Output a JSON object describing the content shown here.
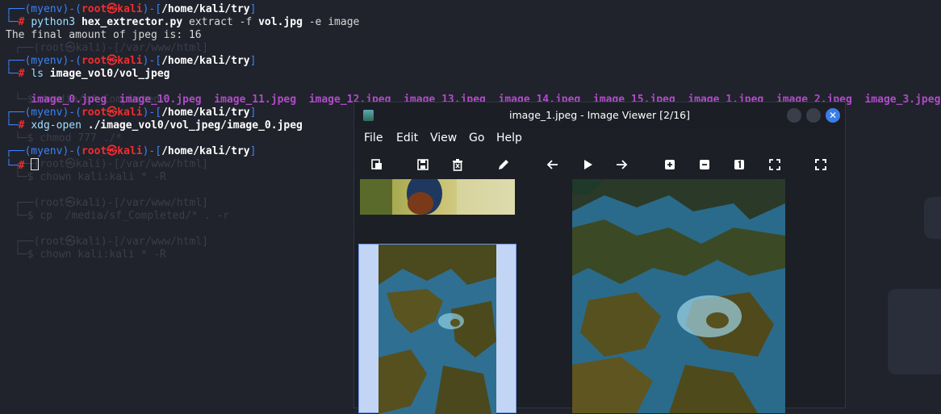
{
  "terminal": {
    "blocks": [
      {
        "prompt": {
          "env": "(myenv)",
          "user": "root",
          "host": "kali",
          "path": "/home/kali/try"
        },
        "command": {
          "cmd": "python3",
          "script": "hex_extrector.py",
          "flag1": "extract -f",
          "file": "vol.jpg",
          "rest": "-e image"
        },
        "output": "The final amount of jpeg is: 16"
      },
      {
        "prompt": {
          "env": "(myenv)",
          "user": "root",
          "host": "kali",
          "path": "/home/kali/try"
        },
        "command": {
          "cmd": "ls",
          "arg": "image_vol0/vol_jpeg"
        },
        "files": [
          "image_0.jpeg",
          "image_10.jpeg",
          "image_11.jpeg",
          "image_12.jpeg",
          "image_13.jpeg",
          "image_14.jpeg",
          "image_15.jpeg",
          "image_1.jpeg",
          "image_2.jpeg",
          "image_3.jpeg"
        ]
      },
      {
        "prompt": {
          "env": "(myenv)",
          "user": "root",
          "host": "kali",
          "path": "/home/kali/try"
        },
        "command": {
          "cmd": "xdg-open",
          "arg": "./image_vol0/vol_jpeg/image_0.jpeg"
        }
      },
      {
        "prompt": {
          "env": "(myenv)",
          "user": "root",
          "host": "kali",
          "path": "/home/kali/try"
        }
      }
    ],
    "ghost_lines": [
      "/var/www/html",
      "/media/sf_Completed/",
      "chmod 777 ./*",
      "/var/www/html",
      "chown kali:kali * -R",
      "/var/www/html",
      "cp  /media/sf_Completed/* . -r",
      "/var/www/html",
      "chown kali:kali * -R"
    ]
  },
  "viewer": {
    "title": "image_1.jpeg - Image Viewer [2/16]",
    "menu": [
      "File",
      "Edit",
      "View",
      "Go",
      "Help"
    ],
    "close_glyph": "✕"
  },
  "colors": {
    "accent": "#3b7de6",
    "prompt_frame": "#3b82f6",
    "root": "#ef2f2f",
    "ls_entries": "#b04cc8"
  }
}
